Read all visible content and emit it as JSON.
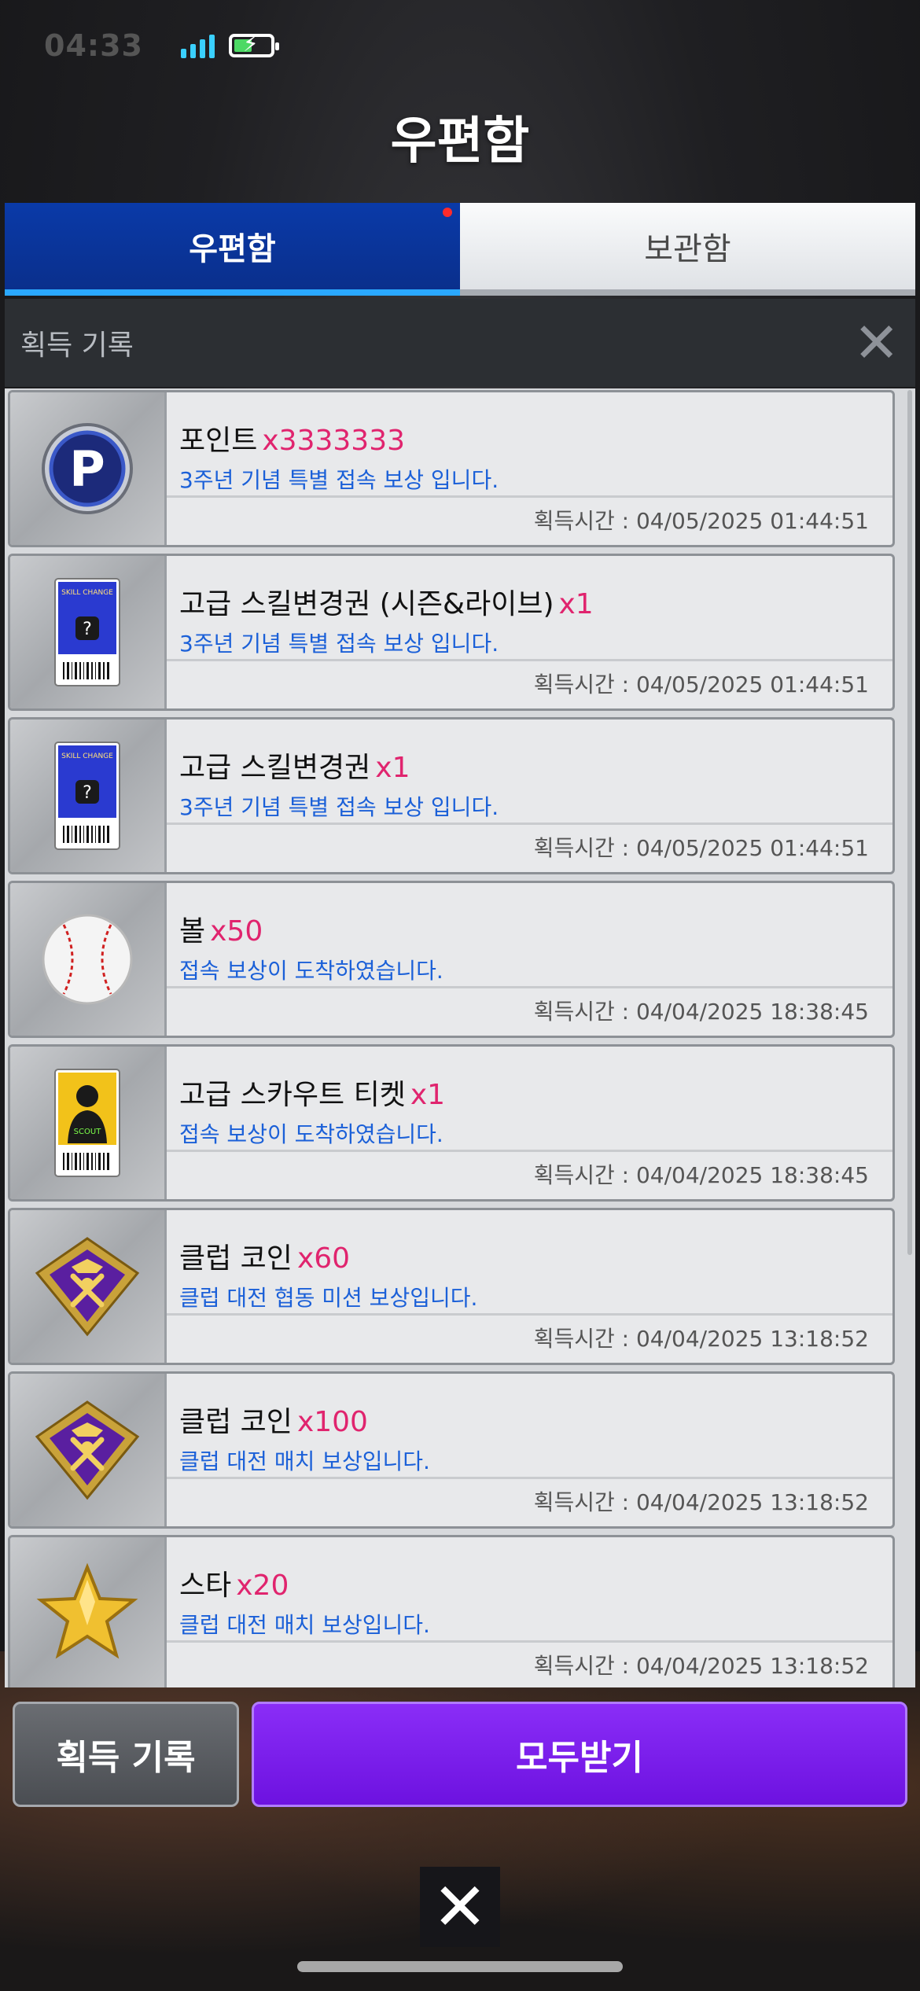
{
  "status": {
    "time": "04:33"
  },
  "header": {
    "title": "우편함"
  },
  "tabs": [
    {
      "label": "우편함"
    },
    {
      "label": "보관함"
    }
  ],
  "subheader": {
    "label": "획득 기록"
  },
  "items": [
    {
      "icon": "point-icon",
      "name": "포인트",
      "qty": "x3333333",
      "desc": "3주년 기념 특별 접속 보상 입니다.",
      "time": "획득시간 : 04/05/2025 01:44:51"
    },
    {
      "icon": "skill-change-ticket-icon",
      "name": "고급 스킬변경권 (시즌&라이브)",
      "qty": "x1",
      "desc": "3주년 기념 특별 접속 보상 입니다.",
      "time": "획득시간 : 04/05/2025 01:44:51"
    },
    {
      "icon": "skill-change-ticket-icon",
      "name": "고급 스킬변경권",
      "qty": "x1",
      "desc": "3주년 기념 특별 접속 보상 입니다.",
      "time": "획득시간 : 04/05/2025 01:44:51"
    },
    {
      "icon": "baseball-icon",
      "name": "볼",
      "qty": "x50",
      "desc": "접속 보상이 도착하였습니다.",
      "time": "획득시간 : 04/04/2025 18:38:45"
    },
    {
      "icon": "scout-ticket-icon",
      "name": "고급 스카우트 티켓",
      "qty": "x1",
      "desc": "접속 보상이 도착하였습니다.",
      "time": "획득시간 : 04/04/2025 18:38:45"
    },
    {
      "icon": "club-coin-icon",
      "name": "클럽 코인",
      "qty": "x60",
      "desc": "클럽 대전 협동 미션 보상입니다.",
      "time": "획득시간 : 04/04/2025 13:18:52"
    },
    {
      "icon": "club-coin-icon",
      "name": "클럽 코인",
      "qty": "x100",
      "desc": "클럽 대전 매치 보상입니다.",
      "time": "획득시간 : 04/04/2025 13:18:52"
    },
    {
      "icon": "star-icon",
      "name": "스타",
      "qty": "x20",
      "desc": "클럽 대전 매치 보상입니다.",
      "time": "획득시간 : 04/04/2025 13:18:52"
    }
  ],
  "buttons": {
    "history": "획득 기록",
    "receive_all": "모두받기",
    "close": "✕"
  }
}
